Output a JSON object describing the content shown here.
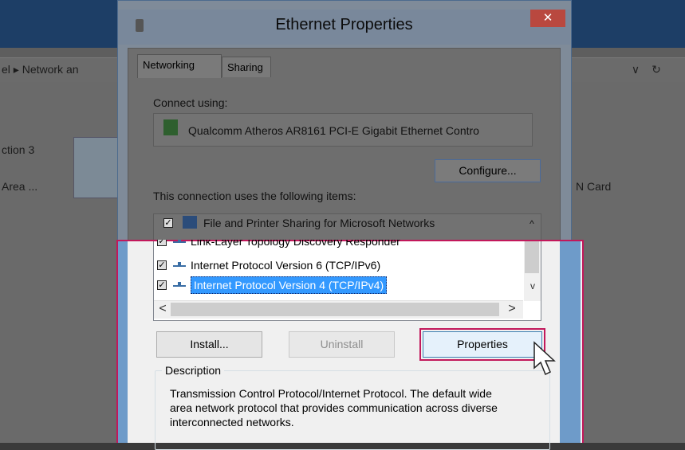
{
  "background_window": {
    "address_text": "el ▸ Network an",
    "dropdown_glyph": "∨",
    "refresh_glyph": "↻",
    "item_left_title": "ction 3",
    "item_left_sub": "Area ...",
    "item_right_sub": "N Card"
  },
  "dialog": {
    "title": "Ethernet Properties",
    "close_label": "✕",
    "tabs": [
      {
        "label": "Networking",
        "active": true
      },
      {
        "label": "Sharing",
        "active": false
      }
    ],
    "connect_using_label": "Connect using:",
    "adapter_name": "Qualcomm Atheros AR8161 PCI-E Gigabit Ethernet Contro",
    "configure_label": "Configure...",
    "items_label": "This connection uses the following items:",
    "items": [
      {
        "label": "File and Printer Sharing for Microsoft Networks",
        "checked": true,
        "selected": false
      },
      {
        "label": "Link-Layer Topology Discovery Responder",
        "checked": true,
        "selected": false
      },
      {
        "label": "Internet Protocol Version 6 (TCP/IPv6)",
        "checked": true,
        "selected": false
      },
      {
        "label": "Internet Protocol Version 4 (TCP/IPv4)",
        "checked": true,
        "selected": true
      }
    ],
    "check_glyph": "✓",
    "scroll_up": "^",
    "scroll_down": "v",
    "scroll_left": "<",
    "scroll_right": ">",
    "install_label": "Install...",
    "uninstall_label": "Uninstall",
    "properties_label": "Properties",
    "description_label": "Description",
    "description_text": "Transmission Control Protocol/Internet Protocol. The default wide area network protocol that provides communication across diverse interconnected networks."
  },
  "colors": {
    "highlight_border": "#c2185b",
    "selection": "#3399ff",
    "close_button": "#b9483f"
  }
}
